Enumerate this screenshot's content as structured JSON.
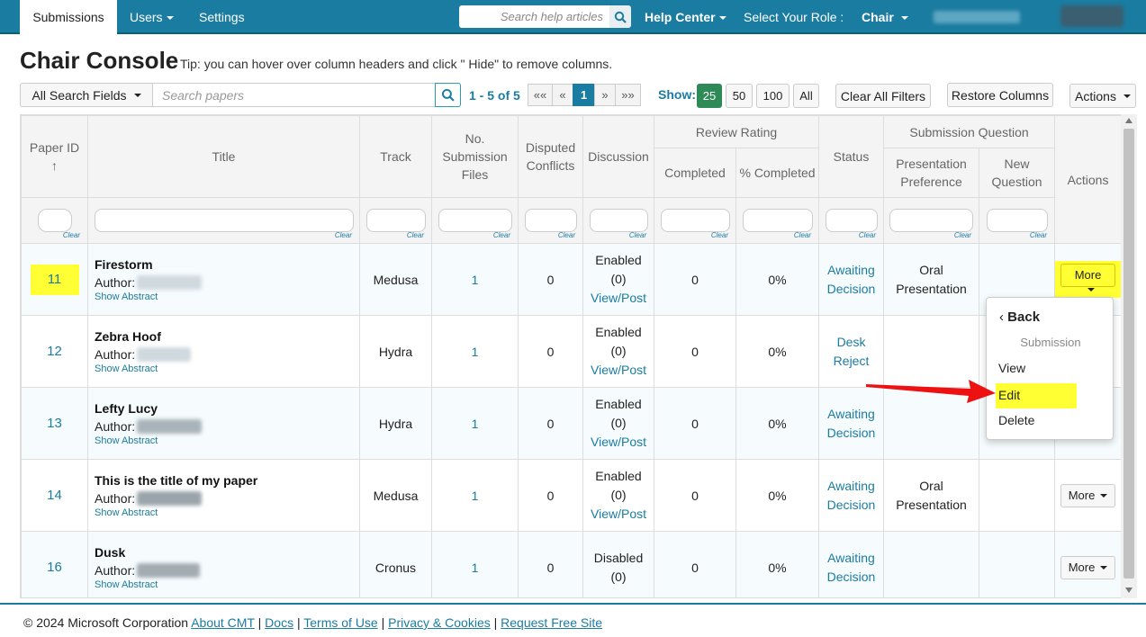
{
  "nav": {
    "active_tab": "Submissions",
    "users": "Users",
    "settings": "Settings",
    "help_search_placeholder": "Search help articles",
    "help_center": "Help Center",
    "role_label": "Select Your Role :",
    "role_value": "Chair"
  },
  "page": {
    "title": "Chair Console",
    "tip": "Tip: you can hover over column headers and click \" Hide\" to remove columns."
  },
  "toolbar": {
    "search_fields": "All Search Fields",
    "search_placeholder": "Search papers",
    "pager_info": "1 - 5 of 5",
    "pager_first": "««",
    "pager_prev": "«",
    "pager_current": "1",
    "pager_next": "»",
    "pager_last": "»»",
    "show_label": "Show:",
    "show_options": [
      "25",
      "50",
      "100",
      "All"
    ],
    "clear_filters": "Clear All Filters",
    "restore_columns": "Restore Columns",
    "actions": "Actions"
  },
  "table": {
    "headers": {
      "paper_id": "Paper ID",
      "sort_arrow": "↑",
      "title": "Title",
      "track": "Track",
      "no_submission_files": "No. Submission Files",
      "disputed_conflicts": "Disputed Conflicts",
      "discussion": "Discussion",
      "review_rating": "Review Rating",
      "completed": "Completed",
      "pct_completed": "% Completed",
      "status": "Status",
      "submission_question": "Submission Question",
      "presentation_preference": "Presentation Preference",
      "new_question": "New Question",
      "actions": "Actions"
    },
    "clear_label": "Clear",
    "rows": [
      {
        "id": "11",
        "title": "Firestorm",
        "author_label": "Author:",
        "abstract": "Show Abstract",
        "track": "Medusa",
        "files": "1",
        "conflicts": "0",
        "discussion_state": "Enabled",
        "discussion_count": "(0)",
        "discussion_link": "View/Post",
        "completed": "0",
        "pct": "0%",
        "status_line1": "Awaiting",
        "status_line2": "Decision",
        "pres_line1": "Oral",
        "pres_line2": "Presentation",
        "action": "More"
      },
      {
        "id": "12",
        "title": "Zebra Hoof",
        "author_label": "Author:",
        "abstract": "Show Abstract",
        "track": "Hydra",
        "files": "1",
        "conflicts": "0",
        "discussion_state": "Enabled",
        "discussion_count": "(0)",
        "discussion_link": "View/Post",
        "completed": "0",
        "pct": "0%",
        "status_line1": "Desk",
        "status_line2": "Reject",
        "pres_line1": "",
        "pres_line2": "",
        "action": ""
      },
      {
        "id": "13",
        "title": "Lefty Lucy",
        "author_label": "Author:",
        "abstract": "Show Abstract",
        "track": "Hydra",
        "files": "1",
        "conflicts": "0",
        "discussion_state": "Enabled",
        "discussion_count": "(0)",
        "discussion_link": "View/Post",
        "completed": "0",
        "pct": "0%",
        "status_line1": "Awaiting",
        "status_line2": "Decision",
        "pres_line1": "",
        "pres_line2": "",
        "action": ""
      },
      {
        "id": "14",
        "title": "This is the title of my paper",
        "author_label": "Author:",
        "abstract": "Show Abstract",
        "track": "Medusa",
        "files": "1",
        "conflicts": "0",
        "discussion_state": "Enabled",
        "discussion_count": "(0)",
        "discussion_link": "View/Post",
        "completed": "0",
        "pct": "0%",
        "status_line1": "Awaiting",
        "status_line2": "Decision",
        "pres_line1": "Oral",
        "pres_line2": "Presentation",
        "action": "More"
      },
      {
        "id": "16",
        "title": "Dusk",
        "author_label": "Author:",
        "abstract": "Show Abstract",
        "track": "Cronus",
        "files": "1",
        "conflicts": "0",
        "discussion_state": "Disabled",
        "discussion_count": "(0)",
        "discussion_link": "",
        "completed": "0",
        "pct": "0%",
        "status_line1": "Awaiting",
        "status_line2": "Decision",
        "pres_line1": "",
        "pres_line2": "",
        "action": "More"
      }
    ]
  },
  "dropdown": {
    "back": "Back",
    "header": "Submission",
    "view": "View",
    "edit": "Edit",
    "delete": "Delete"
  },
  "footer": {
    "copyright": "© 2024 Microsoft Corporation",
    "links": [
      "About CMT",
      "Docs",
      "Terms of Use",
      "Privacy & Cookies",
      "Request Free Site"
    ],
    "separator": "|"
  },
  "colors": {
    "brand": "#1a7ca1",
    "highlight": "#ffff33",
    "show_active": "#2e8b57",
    "annotation_arrow": "#ee1111"
  }
}
